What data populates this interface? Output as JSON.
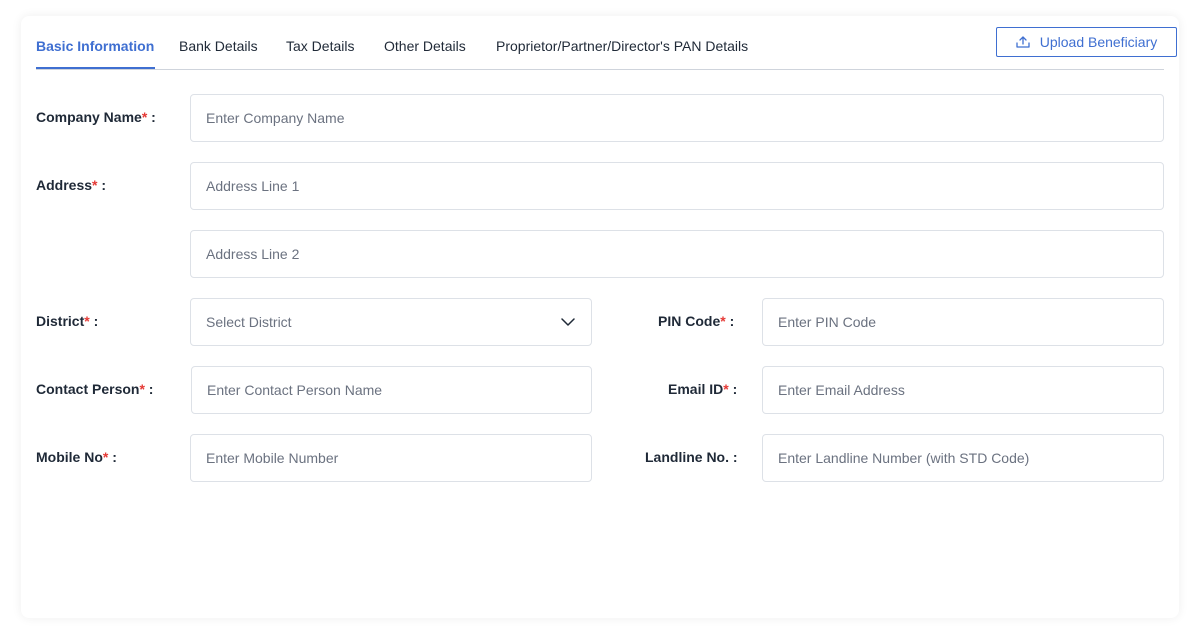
{
  "tabs": [
    {
      "label": "Basic Information",
      "active": true
    },
    {
      "label": "Bank Details",
      "active": false
    },
    {
      "label": "Tax Details",
      "active": false
    },
    {
      "label": "Other Details",
      "active": false
    },
    {
      "label": "Proprietor/Partner/Director's PAN Details",
      "active": false
    }
  ],
  "upload_button": {
    "label": "Upload Beneficiary",
    "icon": "upload-icon"
  },
  "form": {
    "company_name": {
      "label": "Company Name",
      "required_mark": "*",
      "suffix": " :",
      "placeholder": "Enter Company Name"
    },
    "address": {
      "label": "Address",
      "required_mark": "*",
      "suffix": " :",
      "line1_placeholder": "Address Line 1",
      "line2_placeholder": "Address Line 2"
    },
    "district": {
      "label": "District",
      "required_mark": "*",
      "suffix": " :",
      "placeholder": "Select District",
      "icon": "chevron-down-icon"
    },
    "pin_code": {
      "label": "PIN Code",
      "required_mark": "*",
      "suffix": " :",
      "placeholder": "Enter PIN Code"
    },
    "contact_person": {
      "label": "Contact Person",
      "required_mark": "*",
      "suffix": " :",
      "placeholder": "Enter Contact Person Name"
    },
    "email": {
      "label": "Email ID",
      "required_mark": "*",
      "suffix": " :",
      "placeholder": "Enter Email Address"
    },
    "mobile": {
      "label": "Mobile No",
      "required_mark": "*",
      "suffix": " :",
      "placeholder": "Enter Mobile Number"
    },
    "landline": {
      "label": "Landline No. :",
      "placeholder": "Enter Landline Number (with STD Code)"
    }
  },
  "colors": {
    "accent": "#3f6fd1",
    "required": "#e53935",
    "border": "#dde1e7"
  }
}
